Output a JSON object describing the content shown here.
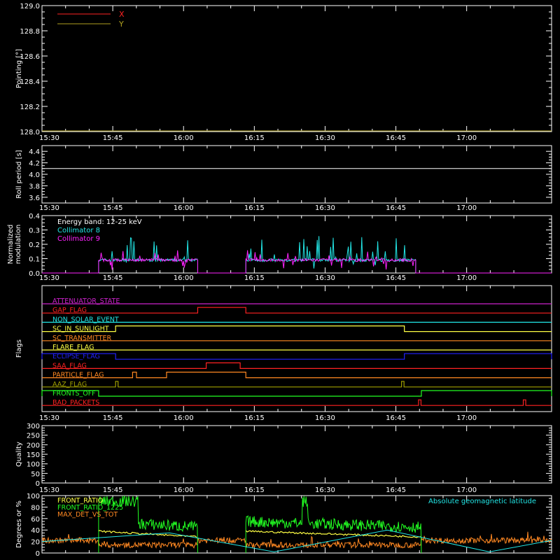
{
  "colors": {
    "background": "#000000",
    "axis": "#ffffff",
    "red": "#ff2222",
    "olive": "#b0a020",
    "white": "#ffffff",
    "cyan": "#22e6e6",
    "magenta": "#ff22ff",
    "blue": "#2222ff",
    "orange": "#ff8822",
    "yellow": "#ffff44",
    "green": "#22ff22",
    "lightgreen": "#88ff44",
    "darkolive": "#a0a000",
    "plum": "#cc22cc",
    "brown": "#cc5522"
  },
  "x_tick_labels": [
    "15:30",
    "15:45",
    "16:00",
    "16:15",
    "16:30",
    "16:45",
    "17:00"
  ],
  "chart_data": [
    {
      "type": "line",
      "ylabel": "Pointing [°]",
      "ylim": [
        128.0,
        129.0
      ],
      "yticks": [
        "128.0",
        "128.2",
        "128.4",
        "128.6",
        "128.8",
        "129.0"
      ],
      "legend": [
        {
          "name": "X",
          "color": "#ff2222"
        },
        {
          "name": "Y",
          "color": "#b0a020"
        }
      ],
      "series": [
        {
          "name": "Y",
          "color": "#b0a020",
          "values": [
            128.0,
            128.0
          ]
        }
      ]
    },
    {
      "type": "line",
      "ylabel": "Roll period [s]",
      "ylim": [
        3.5,
        4.5
      ],
      "yticks": [
        "3.6",
        "3.8",
        "4.0",
        "4.2",
        "4.4"
      ],
      "series": [
        {
          "color": "#ffffff",
          "value": 4.1
        }
      ]
    },
    {
      "type": "line",
      "ylabel": "Normalized modulation",
      "ylabel_lines": [
        "Normalized",
        "modulation"
      ],
      "ylim": [
        0.0,
        0.4
      ],
      "yticks": [
        "0.0",
        "0.1",
        "0.2",
        "0.3",
        "0.4"
      ],
      "legend_title": "Energy band: 12-25 keV",
      "legend": [
        {
          "name": "Collimator 8",
          "color": "#22e6e6"
        },
        {
          "name": "Collimator 9",
          "color": "#ff22ff"
        }
      ],
      "active_intervals": [
        [
          15.7,
          16.05
        ],
        [
          16.22,
          16.82
        ]
      ],
      "baseline": 0.09
    },
    {
      "type": "flags",
      "ylabel": "Flags",
      "flags": [
        {
          "name": "ATTENUATOR_STATE",
          "color": "#cc22cc",
          "high": []
        },
        {
          "name": "GAP_FLAG",
          "color": "#ff2222",
          "high": [
            [
              16.05,
              16.22
            ]
          ]
        },
        {
          "name": "NON_SOLAR_EVENT",
          "color": "#22e6e6",
          "high": []
        },
        {
          "name": "SC_IN_SUNLIGHT",
          "color": "#ffff44",
          "high": [
            [
              15.76,
              16.78
            ]
          ]
        },
        {
          "name": "SC_TRANSMITTER",
          "color": "#ff8822",
          "high": []
        },
        {
          "name": "FLARE_FLAG",
          "color": "#ffff44",
          "high": []
        },
        {
          "name": "ECLIPSE_FLAG",
          "color": "#2222ff",
          "high": [
            [
              15.5,
              15.76
            ],
            [
              16.78,
              17.3
            ]
          ]
        },
        {
          "name": "SAA_FLAG",
          "color": "#ff2222",
          "high": [
            [
              16.08,
              16.2
            ]
          ]
        },
        {
          "name": "PARTICLE_FLAG",
          "color": "#ff8822",
          "high": [
            [
              15.82,
              15.83
            ],
            [
              15.94,
              16.22
            ]
          ]
        },
        {
          "name": "AAZ_FLAG",
          "color": "#a0a000",
          "high": [
            [
              15.76,
              15.765
            ],
            [
              16.77,
              16.775
            ]
          ]
        },
        {
          "name": "FRONTS_OFF",
          "color": "#22ff22",
          "high": [
            [
              15.5,
              15.7
            ],
            [
              16.84,
              17.3
            ]
          ]
        },
        {
          "name": "BAD_PACKETS",
          "color": "#ff2222",
          "high": [
            [
              16.83,
              16.835
            ],
            [
              17.2,
              17.205
            ]
          ]
        }
      ]
    },
    {
      "type": "line",
      "ylabel": "Quality",
      "ylim": [
        0,
        300
      ],
      "yticks": [
        "0",
        "50",
        "100",
        "150",
        "200",
        "250",
        "300"
      ]
    },
    {
      "type": "line",
      "ylabel": "Degrees or %",
      "ylim": [
        0,
        100
      ],
      "yticks": [
        "0",
        "20",
        "40",
        "60",
        "80",
        "100"
      ],
      "annotation": {
        "text": "Absolute geomagnetic latitude",
        "color": "#22e6e6"
      },
      "legend": [
        {
          "name": "FRONT_RATIO",
          "color": "#ffff44"
        },
        {
          "name": "FRONT_RATIO_1225",
          "color": "#22ff22"
        },
        {
          "name": "MAX_DET_VS_TOT",
          "color": "#ff8822"
        }
      ],
      "geomag_latitude": {
        "x": [
          15.5,
          15.95,
          16.32,
          16.72,
          17.08,
          17.3
        ],
        "y": [
          20,
          35,
          2,
          40,
          2,
          22
        ]
      }
    }
  ]
}
